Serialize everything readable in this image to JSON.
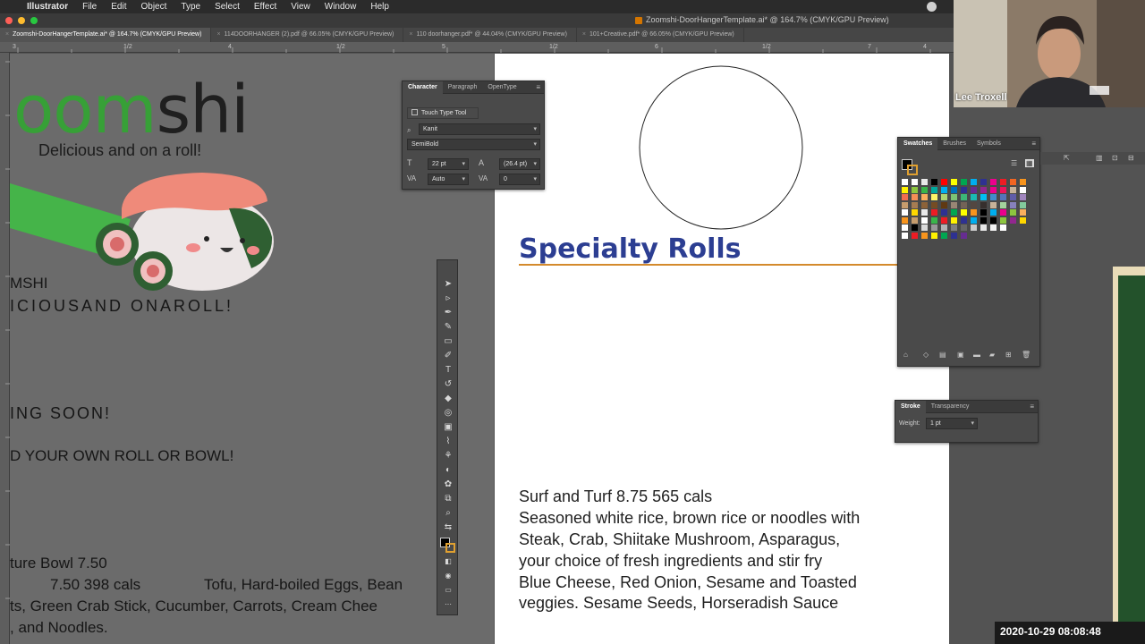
{
  "menubar": {
    "app_name": "Illustrator",
    "items": [
      "File",
      "Edit",
      "Object",
      "Type",
      "Select",
      "Effect",
      "View",
      "Window",
      "Help"
    ]
  },
  "window": {
    "title": "Zoomshi-DoorHangerTemplate.ai* @ 164.7% (CMYK/GPU Preview)"
  },
  "tabs": [
    {
      "label": "Zoomshi-DoorHangerTemplate.ai* @ 164.7% (CMYK/GPU Preview)",
      "active": true
    },
    {
      "label": "114DOORHANGER (2).pdf @ 66.05% (CMYK/GPU Preview)",
      "active": false
    },
    {
      "label": "110 doorhanger.pdf* @ 44.04% (CMYK/GPU Preview)",
      "active": false
    },
    {
      "label": "101+Creative.pdf* @ 66.05% (CMYK/GPU Preview)",
      "active": false
    }
  ],
  "ruler": {
    "top_labels": [
      "3",
      "1/2",
      "4",
      "1/2",
      "5",
      "1/2",
      "6",
      "1/2",
      "7",
      "1/2",
      "8",
      "1/2",
      "9",
      "1/2",
      "1/2",
      "1/2",
      "4"
    ],
    "left_labels": [
      "1",
      "2",
      "3",
      "4",
      "5",
      "6",
      "7",
      "8",
      "9",
      "10"
    ]
  },
  "left_artboard": {
    "logo_green": "oom",
    "logo_dark": "shi",
    "tagline": "Delicious and on a roll!",
    "line_brand": "MSHI",
    "line_slogan": "ICIOUSAND ONAROLL!",
    "line_coming": "ING   SOON!",
    "line_build": "D YOUR OWN ROLL OR BOWL!",
    "line_bowl": "ture Bowl  7.50",
    "line_price": "7.50  398 cals",
    "line_tofu": "Tofu, Hard-boiled Eggs, Bean",
    "line_crab": "ts, Green Crab Stick, Cucumber, Carrots, Cream Chee",
    "line_noodles": ", and Noodles."
  },
  "right_artboard": {
    "heading": "Specialty Rolls",
    "menu_lines": [
      "Surf and Turf 8.75  565 cals",
      "Seasoned white rice, brown rice or noodles with",
      "Steak, Crab, Shiitake Mushroom, Asparagus,",
      "your choice of fresh ingredients and stir fry",
      "Blue Cheese, Red Onion, Sesame and Toasted",
      "veggies. Sesame Seeds, Horseradish Sauce"
    ]
  },
  "character_panel": {
    "tabs": [
      "Character",
      "Paragraph",
      "OpenType"
    ],
    "touch_type_label": "Touch Type Tool",
    "font_family": "Kanit",
    "font_style": "SemiBold",
    "font_size": "22 pt",
    "leading": "(26.4 pt)",
    "kerning": "Auto",
    "tracking": "0"
  },
  "swatches_panel": {
    "tabs": [
      "Swatches",
      "Brushes",
      "Symbols"
    ],
    "colors": [
      [
        "#ffffff",
        "#ffffff",
        "#e9e9e9",
        "#000000",
        "#ff0000",
        "#ffff00",
        "#00a651",
        "#00aeef",
        "#2e3192",
        "#ec008c",
        "#ed1c24",
        "#f26522",
        "#f7941d"
      ],
      [
        "#fff200",
        "#8dc63f",
        "#39b54a",
        "#00a99d",
        "#00aeef",
        "#0072bc",
        "#2e3192",
        "#662d91",
        "#92278f",
        "#ec008c",
        "#ed145b",
        "#c7b299",
        "#ffffff"
      ],
      [
        "#f26c4f",
        "#f68e56",
        "#fbaf5d",
        "#fff568",
        "#acd373",
        "#7cc576",
        "#3cb878",
        "#1abbb4",
        "#00bff3",
        "#438ccb",
        "#5674b9",
        "#605ca8",
        "#a186be"
      ],
      [
        "#c69c6d",
        "#a67c52",
        "#8c6239",
        "#754c24",
        "#603913",
        "#998675",
        "#736357",
        "#534741",
        "#362f2d",
        "#c7b299",
        "#a3d39c",
        "#8781bd",
        "#82ca9c"
      ],
      [
        "#ffffff",
        "#ffd700",
        "#e9e9e9",
        "#ed1c24",
        "#2e3192",
        "#00a651",
        "#ffff00",
        "#f7941d",
        "#000000",
        "#00aeef",
        "#ec008c",
        "#8dc63f",
        "#fbaf5d"
      ],
      [
        "#f7941d",
        "#c69c6d",
        "#ffffff",
        "#39b54a",
        "#ed1c24",
        "#fff200",
        "#2e3192",
        "#00aeef",
        "#000000",
        "#000000",
        "#8dc63f",
        "#92278f",
        "#ffd700"
      ],
      [
        "#ffffff",
        "#000000",
        "#d9d9d9",
        "#999999",
        "#b3b3b3",
        "#808080",
        "#666666",
        "#cccccc",
        "#e6e6e6",
        "#f2f2f2",
        "#ffffff",
        "",
        ""
      ],
      [
        "#ffffff",
        "#ed1c24",
        "#f7941d",
        "#fff200",
        "#00a651",
        "#2e3192",
        "#662d91",
        "",
        "",
        "",
        "",
        "",
        ""
      ]
    ]
  },
  "stroke_panel": {
    "tabs": [
      "Stroke",
      "Transparency"
    ],
    "weight_label": "Weight:",
    "weight_value": "1 pt"
  },
  "webcam": {
    "name": "Lee Troxell"
  },
  "timestamp": "2020-10-29  08:08:48"
}
